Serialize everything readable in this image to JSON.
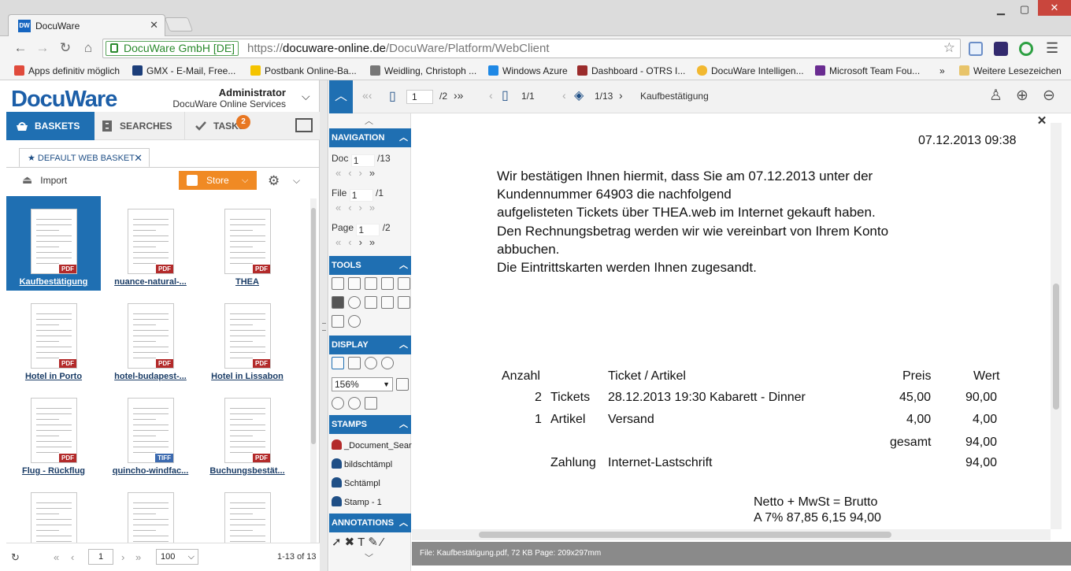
{
  "browser": {
    "tab_title": "DocuWare",
    "tab_favicon": "DW",
    "secure_label": "DocuWare GmbH [DE]",
    "url_scheme": "https://",
    "url_host": "docuware-online.de",
    "url_path": "/DocuWare/Platform/WebClient",
    "bookmarks": [
      {
        "label": "Apps definitiv möglich",
        "color": "#e04b3c"
      },
      {
        "label": "GMX - E-Mail, Free...",
        "color": "#1c3e7a"
      },
      {
        "label": "Postbank Online-Ba...",
        "color": "#f5c400"
      },
      {
        "label": "Weidling, Christoph ...",
        "color": "#777777"
      },
      {
        "label": "Windows Azure",
        "color": "#1e88e5"
      },
      {
        "label": "Dashboard - OTRS I...",
        "color": "#9b2c2c"
      },
      {
        "label": "DocuWare Intelligen...",
        "color": "#f2b830"
      },
      {
        "label": "Microsoft Team Fou...",
        "color": "#6a2c91"
      }
    ],
    "bookmarks_more": "»",
    "other_bookmarks": "Weitere Lesezeichen"
  },
  "app": {
    "logo": "DocuWare",
    "user_name": "Administrator",
    "service_name": "DocuWare Online Services",
    "tabs": {
      "baskets": "BASKETS",
      "searches": "SEARCHES",
      "tasks": "TASKS"
    },
    "tasks_badge": "2",
    "basket_tab": "DEFAULT WEB BASKET",
    "import_label": "Import",
    "store_label": "Store",
    "documents": [
      {
        "label": "Kaufbestätigung",
        "type": "PDF",
        "selected": true
      },
      {
        "label": "nuance-natural-...",
        "type": "PDF",
        "selected": false
      },
      {
        "label": "THEA",
        "type": "PDF",
        "selected": false
      },
      {
        "label": "Hotel in Porto",
        "type": "PDF",
        "selected": false
      },
      {
        "label": "hotel-budapest-...",
        "type": "PDF",
        "selected": false
      },
      {
        "label": "Hotel in Lissabon",
        "type": "PDF",
        "selected": false
      },
      {
        "label": "Flug - Rückflug",
        "type": "PDF",
        "selected": false
      },
      {
        "label": "quincho-windfac...",
        "type": "TIFF",
        "selected": false
      },
      {
        "label": "Buchungsbestät...",
        "type": "PDF",
        "selected": false
      },
      {
        "label": "",
        "type": "",
        "selected": false
      },
      {
        "label": "",
        "type": "",
        "selected": false
      },
      {
        "label": "",
        "type": "",
        "selected": false
      }
    ],
    "pager": {
      "page": "1",
      "page_size": "100",
      "count_text": "1-13 of 13"
    }
  },
  "viewer": {
    "page_current": "1",
    "page_total": "/2",
    "file_index": "1/1",
    "doc_index": "1/13",
    "doc_name": "Kaufbestätigung",
    "nav": {
      "header": "NAVIGATION",
      "doc_label": "Doc",
      "doc_value": "1",
      "doc_total": "/13",
      "file_label": "File",
      "file_value": "1",
      "file_total": "/1",
      "page_label": "Page",
      "page_value": "1",
      "page_total": "/2"
    },
    "tools_header": "TOOLS",
    "display_header": "DISPLAY",
    "zoom": "156%",
    "stamps_header": "STAMPS",
    "stamps": [
      {
        "label": "_Document_Sear",
        "color": "#b32a2a"
      },
      {
        "label": "bildschtämpl",
        "color": "#1f4f86"
      },
      {
        "label": "Schtämpl",
        "color": "#1f4f86"
      },
      {
        "label": "Stamp - 1",
        "color": "#1f4f86"
      }
    ],
    "annotations_header": "ANNOTATIONS",
    "status": "File: Kaufbestätigung.pdf, 72 KB Page: 209x297mm"
  },
  "document": {
    "datetime": "07.12.2013 09:38",
    "body_lines": [
      "Wir bestätigen Ihnen hiermit, dass Sie am 07.12.2013 unter der",
      "Kundennummer 64903 die nachfolgend",
      "aufgelisteten Tickets über THEA.web im Internet gekauft haben.",
      "Den Rechnungsbetrag werden wir wie vereinbart von Ihrem Konto",
      "abbuchen.",
      "Die Eintrittskarten werden Ihnen zugesandt."
    ],
    "table_headers": {
      "qty": "Anzahl",
      "item": "Ticket / Artikel",
      "price": "Preis",
      "value": "Wert"
    },
    "rows": [
      {
        "qty": "2",
        "type": "Tickets",
        "desc": "28.12.2013 19:30 Kabarett - Dinner",
        "price": "45,00",
        "value": "90,00"
      },
      {
        "qty": "1",
        "type": "Artikel",
        "desc": "Versand",
        "price": "4,00",
        "value": "4,00"
      }
    ],
    "total_label": "gesamt",
    "total_value": "94,00",
    "payment_label": "Zahlung",
    "payment_method": "Internet-Lastschrift",
    "payment_value": "94,00",
    "tax_header": "Netto + MwSt = Brutto",
    "tax_line": "A 7% 87,85 6,15 94,00"
  }
}
